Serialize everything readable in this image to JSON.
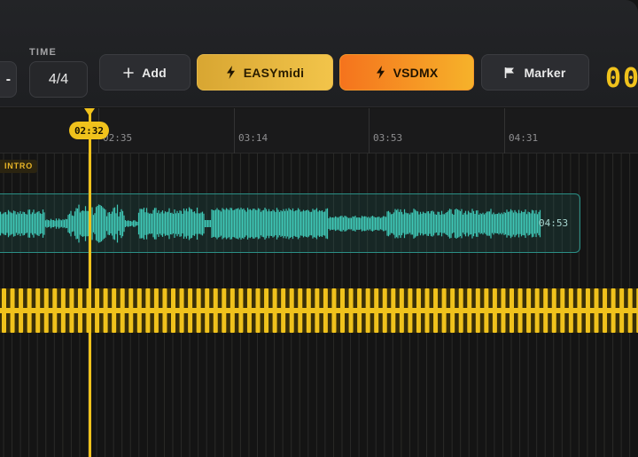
{
  "toolbar": {
    "partial_left_symbol": "-",
    "time_label": "TIME",
    "time_signature": "4/4",
    "add_label": "Add",
    "easymidi_label": "EASYmidi",
    "vsdmx_label": "VSDMX",
    "marker_label": "Marker",
    "counter_partial": "00"
  },
  "timeline": {
    "ticks": [
      "02:35",
      "03:14",
      "03:53",
      "04:31"
    ],
    "playhead_time": "02:32"
  },
  "tracks": {
    "section_label": "INTRO",
    "audio_clip_end": "04:53"
  },
  "colors": {
    "accent": "#f0c21c",
    "audio": "#3fc7b6",
    "vsdmx_from": "#f5731d",
    "vsdmx_to": "#f6b22a",
    "easymidi_from": "#d8a632",
    "easymidi_to": "#f2c44a"
  }
}
